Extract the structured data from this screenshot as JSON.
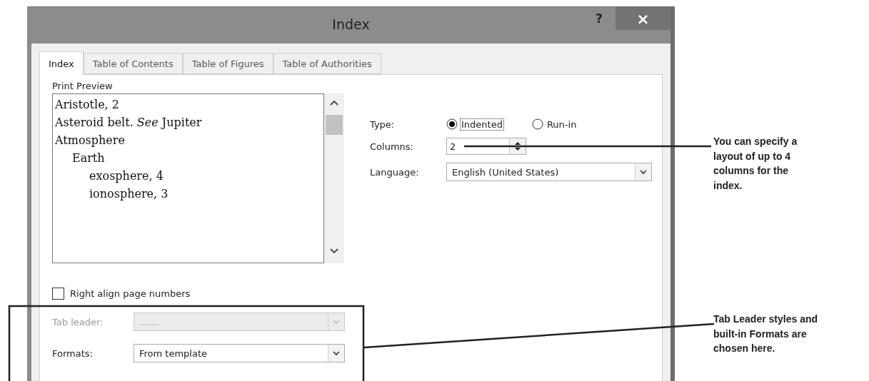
{
  "window": {
    "title": "Index"
  },
  "title_buttons": [
    {
      "kind": "help",
      "label": "?"
    },
    {
      "kind": "close",
      "label": "×"
    }
  ],
  "tabs": [
    {
      "label": "Index",
      "selected": true
    },
    {
      "label": "Table of Contents",
      "selected": false
    },
    {
      "label": "Table of Figures",
      "selected": false
    },
    {
      "label": "Table of Authorities",
      "selected": false
    }
  ],
  "print_preview": {
    "label": "Print Preview",
    "entries": [
      {
        "text": "Aristotle, 2"
      },
      {
        "text": "Asteroid belt. *See* Jupiter"
      },
      {
        "text": "Atmosphere",
        "children": [
          {
            "text": "Earth",
            "children": [
              {
                "text": "exosphere, 4"
              },
              {
                "text": "ionosphere, 3"
              }
            ]
          }
        ]
      }
    ]
  },
  "type": {
    "label": "Type:",
    "options": [
      {
        "label": "Indented",
        "selected": true
      },
      {
        "label": "Run-in",
        "selected": false
      }
    ]
  },
  "columns": {
    "label": "Columns:",
    "value": "2"
  },
  "language": {
    "label": "Language:",
    "value": "English (United States)"
  },
  "right_align": {
    "label": "Right align page numbers",
    "checked": false
  },
  "tab_leader": {
    "label": "Tab leader:",
    "value": ".......",
    "disabled": true
  },
  "formats": {
    "label": "Formats:",
    "value": "From template",
    "disabled": false
  },
  "callouts": [
    {
      "text": "You can specify a layout of up to 4 columns for the index."
    },
    {
      "text": "Tab Leader styles and built-in Formats are chosen here."
    }
  ]
}
